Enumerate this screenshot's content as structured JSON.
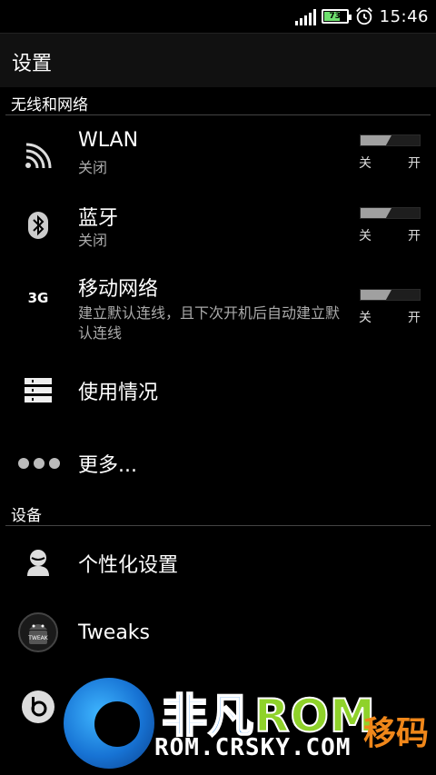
{
  "status_bar": {
    "battery_level": "73",
    "battery_fill_fraction": 0.73,
    "battery_color": "#6ee06e",
    "time": "15:46",
    "signal_icon": "signal-bars",
    "alarm_icon": "alarm-clock"
  },
  "action_bar": {
    "title": "设置"
  },
  "sections": {
    "wireless": {
      "label": "无线和网络"
    },
    "device": {
      "label": "设备"
    }
  },
  "rows": {
    "wlan": {
      "title": "WLAN",
      "subtitle": "关闭",
      "icon": "wifi-icon",
      "toggle_state": "off"
    },
    "bluetooth": {
      "title": "蓝牙",
      "subtitle": "关闭",
      "icon": "bluetooth-icon",
      "toggle_state": "off"
    },
    "mobile": {
      "title": "移动网络",
      "subtitle": "建立默认连线，且下次开机后自动建立默认连线",
      "icon": "3g-icon",
      "icon_text": "3G",
      "toggle_state": "off"
    },
    "usage": {
      "title": "使用情况",
      "icon": "data-usage-icon"
    },
    "more": {
      "title": "更多...",
      "icon": "more-dots-icon"
    },
    "personalize": {
      "title": "个性化设置",
      "icon": "person-icon"
    },
    "tweaks": {
      "title": "Tweaks",
      "icon": "android-tweaks-icon"
    }
  },
  "toggle_labels": {
    "off": "关",
    "on": "开"
  },
  "watermark": {
    "brand_cn": "非凡",
    "brand_rom": "ROM",
    "url": "ROM.CRSKY.COM",
    "side_text": "移码"
  }
}
